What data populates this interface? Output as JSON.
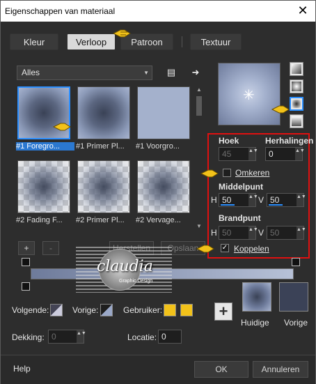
{
  "window": {
    "title": "Eigenschappen van materiaal",
    "close_glyph": "✕"
  },
  "tabs": [
    {
      "label": "Kleur",
      "active": false
    },
    {
      "label": "Verloop",
      "active": true
    },
    {
      "label": "Patroon",
      "active": false
    },
    {
      "label": "Textuur",
      "active": false
    }
  ],
  "library": {
    "category": "Alles",
    "scroll_up": "▲",
    "scroll_down": "▼",
    "add_label": "+",
    "remove_label": "-",
    "restore_label": "Herstellen",
    "save_label": "Opslaan",
    "thumbnails": [
      {
        "label": "#1 Foregro...",
        "selected": true
      },
      {
        "label": "#1 Primer Pl...",
        "selected": false
      },
      {
        "label": "#1 Voorgro...",
        "selected": false
      },
      {
        "label": "#2 Fading F...",
        "selected": false
      },
      {
        "label": "#2 Primer Pl...",
        "selected": false
      },
      {
        "label": "#2 Vervage...",
        "selected": false
      }
    ]
  },
  "properties": {
    "angle_label": "Hoek",
    "angle_value": "45",
    "repeats_label": "Herhalingen",
    "repeats_value": "0",
    "invert_label": "Omkeren",
    "invert_checked": false,
    "midpoint_label": "Middelpunt",
    "mid_h_label": "H",
    "mid_h_value": "50",
    "mid_v_label": "V",
    "mid_v_value": "50",
    "focal_label": "Brandpunt",
    "focal_h_label": "H",
    "focal_h_value": "50",
    "focal_v_label": "V",
    "focal_v_value": "50",
    "link_label": "Koppelen",
    "link_checked": true,
    "spin_arrows": "▲▼"
  },
  "watermark": {
    "logo": "claudia",
    "sub": "Graphic Design"
  },
  "bottom": {
    "follow_label": "Volgende:",
    "previous_label": "Vorige:",
    "user_label": "Gebruiker:",
    "opacity_label": "Dekking:",
    "opacity_value": "0",
    "location_label": "Locatie:",
    "location_value": "0",
    "current_label": "Huidige",
    "previous_swatch_label": "Vorige",
    "add_glyph": "+",
    "user_color": "#f2c21a",
    "previous_color": "#3b4257"
  },
  "footer": {
    "help_label": "Help",
    "ok_label": "OK",
    "cancel_label": "Annuleren"
  }
}
